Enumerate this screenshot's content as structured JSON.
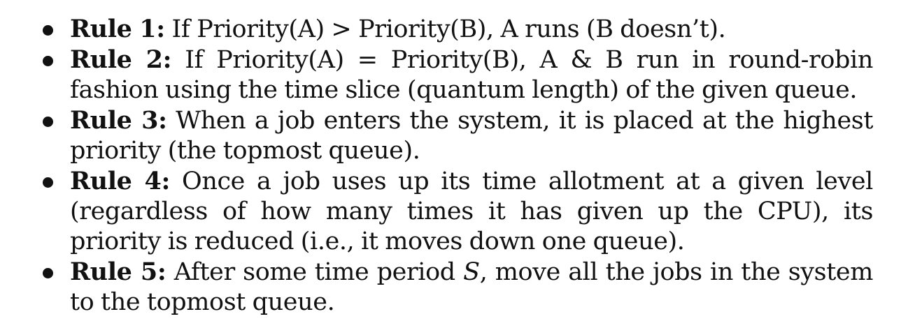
{
  "rules": [
    {
      "label": "Rule 1:",
      "text": "If Priority(A) > Priority(B), A runs (B doesn’t)."
    },
    {
      "label": "Rule 2:",
      "text": "If Priority(A) = Priority(B), A & B run in round-robin fashion using the time slice (quantum length) of the given queue."
    },
    {
      "label": "Rule 3:",
      "text": "When a job enters the system, it is placed at the highest priority (the topmost queue)."
    },
    {
      "label": "Rule 4:",
      "text": "Once a job uses up its time allotment at a given level (regardless of how many times it has given up the CPU), its priority is reduced (i.e., it moves down one queue)."
    },
    {
      "label": "Rule 5:",
      "text_before": "After some time period",
      "variable": "S",
      "text_after": ", move all the jobs in the system to the topmost queue."
    }
  ]
}
